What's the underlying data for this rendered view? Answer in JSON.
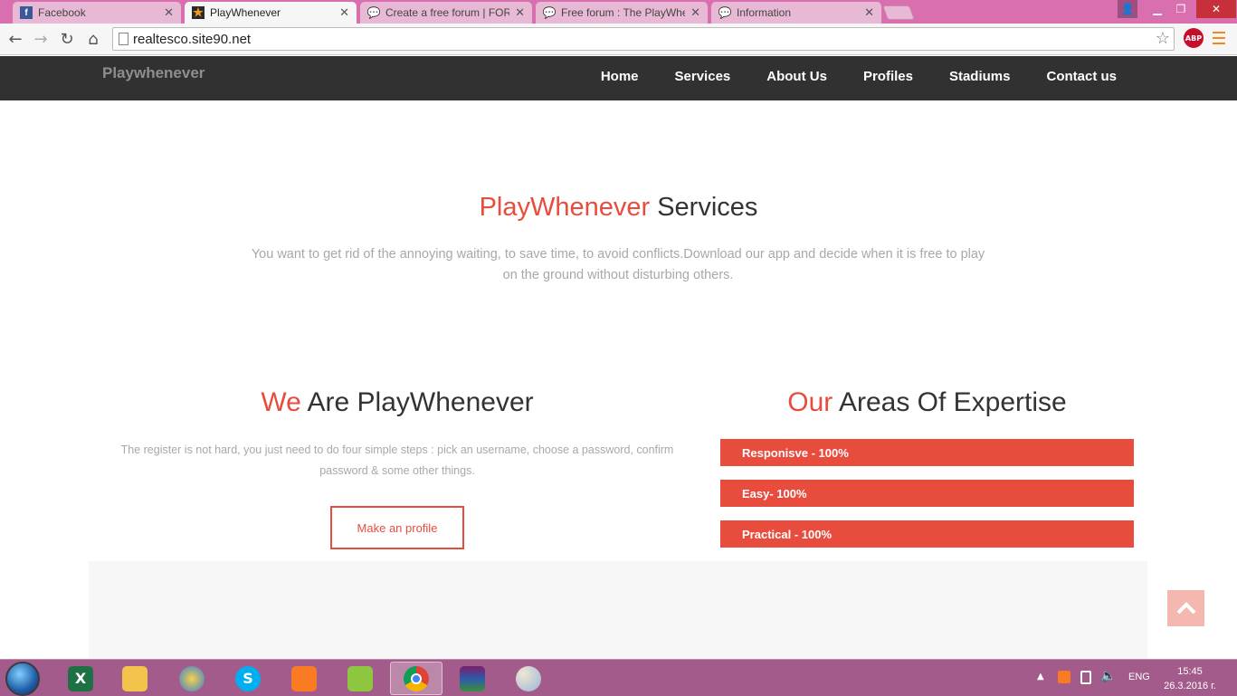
{
  "browser": {
    "tabs": [
      {
        "title": "Facebook",
        "icon": "facebook-icon",
        "active": false
      },
      {
        "title": "PlayWhenever",
        "icon": "star-icon",
        "active": true
      },
      {
        "title": "Create a free forum | FOR",
        "icon": "forum-icon",
        "active": false
      },
      {
        "title": "Free forum : The PlayWhe",
        "icon": "forum-icon",
        "active": false
      },
      {
        "title": "Information",
        "icon": "forum-icon",
        "active": false
      }
    ],
    "url": "realtesco.site90.net",
    "abp_label": "ABP"
  },
  "site": {
    "brand": "Playwhenever",
    "nav": [
      "Home",
      "Services",
      "About Us",
      "Profiles",
      "Stadiums",
      "Contact us"
    ],
    "services": {
      "title_accent": "PlayWhenever",
      "title_rest": " Services",
      "lead": "You want to get rid of the annoying waiting, to save time, to avoid conflicts.Download our app and decide when it is free to play on the ground without disturbing others."
    },
    "about": {
      "title_accent": "We",
      "title_rest": " Are PlayWhenever",
      "text": "The register is not hard, you just need to do four simple steps : pick an username, choose a password, confirm password & some other things.",
      "button": "Make an profile"
    },
    "expertise": {
      "title_accent": "Our",
      "title_rest": " Areas Of Expertise",
      "skills": [
        {
          "label": "Responisve - 100%",
          "level": 100
        },
        {
          "label": "Easy- 100%",
          "level": 100
        },
        {
          "label": "Practical - 100%",
          "level": 100
        }
      ]
    },
    "accent_color": "#e84c3d"
  },
  "taskbar": {
    "apps": [
      "excel-icon",
      "file-explorer-icon",
      "internet-app-icon",
      "skype-icon",
      "xampp-icon",
      "notepad-plus-icon",
      "chrome-icon",
      "winrar-icon",
      "paint-icon"
    ],
    "language": "ENG",
    "time": "15:45",
    "date": "26.3.2016 г."
  }
}
